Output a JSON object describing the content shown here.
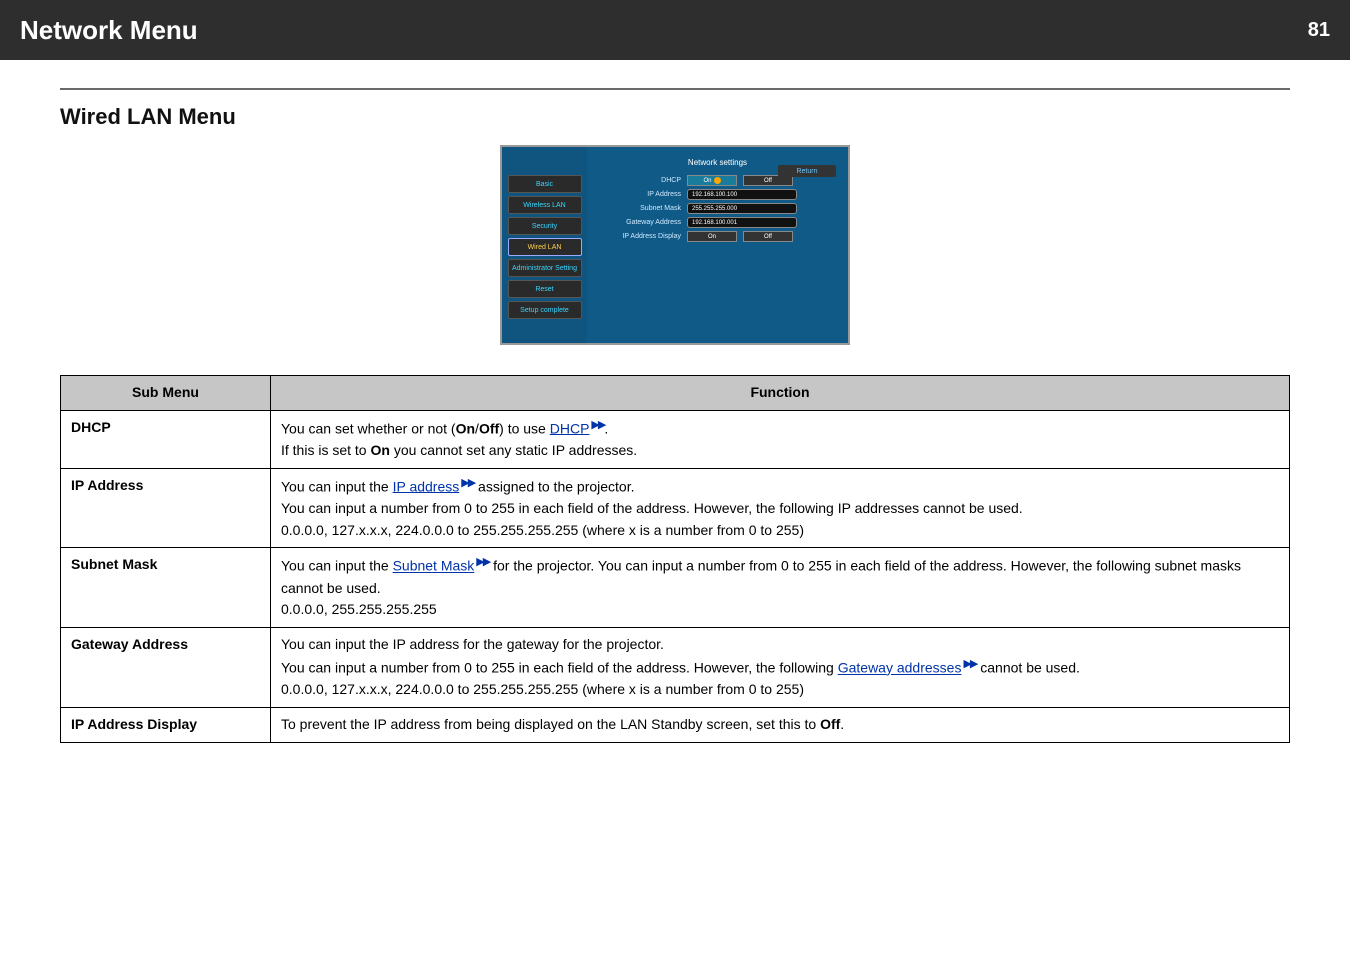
{
  "header": {
    "title": "Network Menu",
    "page": "81"
  },
  "section": {
    "title": "Wired LAN Menu"
  },
  "shot": {
    "panel_title": "Network settings",
    "return_label": "Return",
    "sidebar": [
      "Basic",
      "Wireless LAN",
      "Security",
      "Wired LAN",
      "Administrator Setting",
      "Reset",
      "Setup complete"
    ],
    "rows": {
      "dhcp_label": "DHCP",
      "dhcp_on": "On",
      "dhcp_off": "Off",
      "ip_label": "IP Address",
      "ip_val": "192.168.100.100",
      "mask_label": "Subnet Mask",
      "mask_val": "255.255.255.000",
      "gw_label": "Gateway Address",
      "gw_val": "192.168.100.001",
      "ipdisp_label": "IP Address Display",
      "ipdisp_on": "On",
      "ipdisp_off": "Off"
    }
  },
  "table": {
    "head_sub": "Sub Menu",
    "head_fn": "Function",
    "rows": {
      "dhcp": {
        "name": "DHCP",
        "line1_pre": "You can set whether or not (",
        "line1_on": "On",
        "line1_sep": "/",
        "line1_off": "Off",
        "line1_mid": ") to use ",
        "line1_link": "DHCP",
        "line1_post": ".",
        "line2_pre": "If this is set to ",
        "line2_on": "On",
        "line2_post": " you cannot set any static IP addresses."
      },
      "ip": {
        "name": "IP Address",
        "line1_pre": "You can input the ",
        "line1_link": "IP address",
        "line1_post": " assigned to the projector.",
        "line2": "You can input a number from 0 to 255 in each field of the address. However, the following IP addresses cannot be used.",
        "line3": "0.0.0.0, 127.x.x.x, 224.0.0.0 to 255.255.255.255 (where x is a number from 0 to 255)"
      },
      "mask": {
        "name": "Subnet Mask",
        "line1_pre": "You can input the ",
        "line1_link": "Subnet Mask",
        "line1_post": " for the projector. You can input a number from 0 to 255 in each field of the address. However, the following subnet masks cannot be used.",
        "line2": "0.0.0.0, 255.255.255.255"
      },
      "gw": {
        "name": "Gateway Address",
        "line1": "You can input the IP address for the gateway for the projector.",
        "line2_pre": "You can input a number from 0 to 255 in each field of the address. However, the following ",
        "line2_link": "Gateway addresses",
        "line2_post": " cannot be used.",
        "line3": "0.0.0.0, 127.x.x.x, 224.0.0.0 to 255.255.255.255 (where x is a number from 0 to 255)"
      },
      "ipdisp": {
        "name": "IP Address Display",
        "line1_pre": "To prevent the IP address from being displayed on the LAN Standby screen, set this to ",
        "line1_off": "Off",
        "line1_post": "."
      }
    }
  }
}
